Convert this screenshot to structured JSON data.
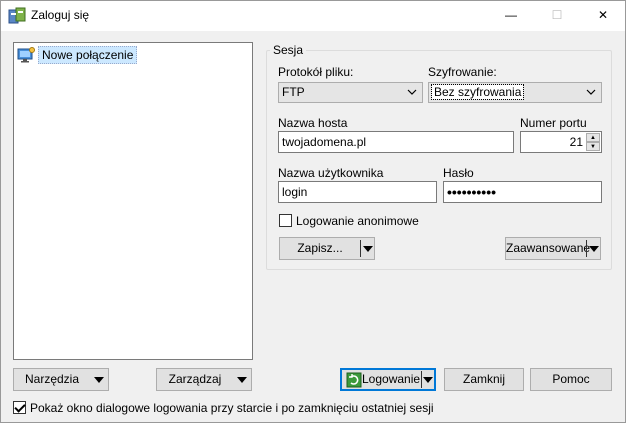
{
  "window": {
    "title": "Zaloguj się",
    "controls": {
      "minimize": "—",
      "maximize": "☐",
      "close": "✕"
    }
  },
  "site_list": {
    "items": [
      {
        "label": "Nowe połączenie"
      }
    ]
  },
  "session": {
    "group_title": "Sesja",
    "protocol": {
      "label": "Protokół pliku:",
      "value": "FTP"
    },
    "encryption": {
      "label": "Szyfrowanie:",
      "value": "Bez szyfrowania"
    },
    "host": {
      "label": "Nazwa hosta",
      "value": "twojadomena.pl"
    },
    "port": {
      "label": "Numer portu",
      "value": "21"
    },
    "username": {
      "label": "Nazwa użytkownika",
      "value": "login"
    },
    "password": {
      "label": "Hasło",
      "value": "••••••••••"
    },
    "anonymous": {
      "label": "Logowanie anonimowe",
      "checked": false
    },
    "save_label": "Zapisz...",
    "advanced_label": "Zaawansowane"
  },
  "bottom": {
    "tools_label": "Narzędzia",
    "manage_label": "Zarządzaj",
    "login_label": "Logowanie",
    "close_label": "Zamknij",
    "help_label": "Pomoc",
    "show_dialog": {
      "label": "Pokaż okno dialogowe logowania przy starcie i po zamknięciu ostatniej sesji",
      "checked": true
    }
  },
  "colors": {
    "accent": "#0078d7",
    "selection": "#cce8ff"
  }
}
